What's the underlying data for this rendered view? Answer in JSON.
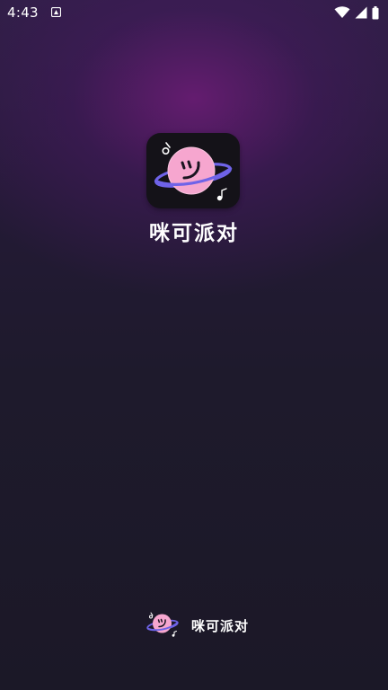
{
  "status_bar": {
    "time": "4:43",
    "icons": [
      "notification-icon",
      "wifi-icon",
      "signal-icon",
      "battery-icon"
    ]
  },
  "splash": {
    "app_name": "咪可派对",
    "icon": "planet-smile-icon"
  },
  "footer": {
    "brand_name": "咪可派对",
    "logo": "planet-smile-icon"
  },
  "colors": {
    "background_top": "#2e1f45",
    "background_bottom": "#1b1827",
    "glow": "#6e1c78",
    "planet_pink": "#f6a6cf",
    "ring_purple": "#6f63e8",
    "icon_background": "#141218"
  }
}
